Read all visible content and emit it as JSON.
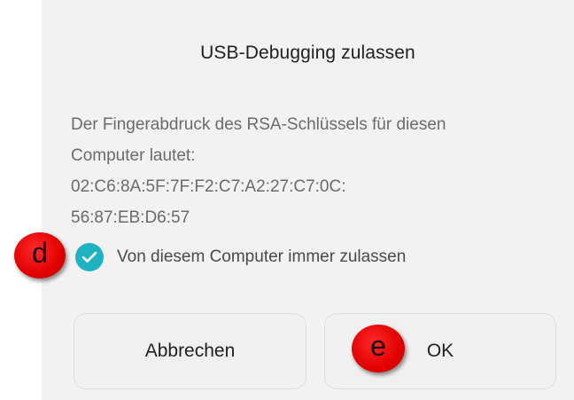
{
  "dialog": {
    "title": "USB-Debugging zulassen",
    "message_lines": [
      "Der Fingerabdruck des RSA-Schlüssels für diesen",
      "Computer lautet:",
      "02:C6:8A:5F:7F:F2:C7:A2:27:C7:0C:",
      "56:87:EB:D6:57"
    ],
    "checkbox": {
      "label": "Von diesem Computer immer zulassen",
      "checked": true,
      "color": "#1fb3c1",
      "icon": "checkmark-icon"
    },
    "buttons": {
      "cancel_label": "Abbrechen",
      "ok_label": "OK"
    }
  },
  "annotations": [
    {
      "label": "d",
      "color": "#e10000"
    },
    {
      "label": "e",
      "color": "#e10000"
    }
  ]
}
